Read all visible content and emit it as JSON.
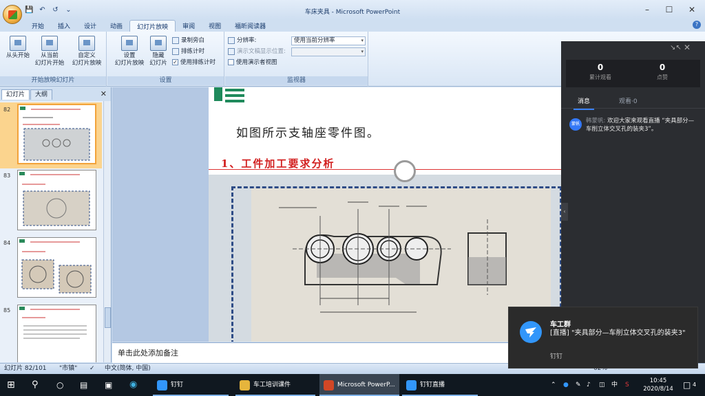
{
  "window": {
    "title": "车床夹具 - Microsoft PowerPoint"
  },
  "ribbon_tabs": [
    "开始",
    "插入",
    "设计",
    "动画",
    "幻灯片放映",
    "审阅",
    "视图",
    "福昕阅读器"
  ],
  "ribbon": {
    "group1": {
      "label": "开始放映幻灯片",
      "buttons": [
        {
          "line1": "从头开始",
          "line2": ""
        },
        {
          "line1": "从当前",
          "line2": "幻灯片开始"
        },
        {
          "line1": "自定义",
          "line2": "幻灯片放映"
        }
      ]
    },
    "group2": {
      "label": "设置",
      "buttons": [
        {
          "line1": "设置",
          "line2": "幻灯片放映"
        },
        {
          "line1": "隐藏",
          "line2": "幻灯片"
        }
      ],
      "small": {
        "record": "录制旁白",
        "rehearse": "排练计时",
        "use_timing": "使用排练计时"
      }
    },
    "group3": {
      "label": "监视器",
      "resolution_label": "分辨率:",
      "resolution_value": "使用当前分辨率",
      "show_on_label": "演示文稿显示位置:",
      "presenter_view": "使用演示者视图"
    }
  },
  "leftpane": {
    "tabs": [
      "幻灯片",
      "大纲"
    ],
    "slide_numbers": [
      "82",
      "83",
      "84",
      "85"
    ]
  },
  "slide": {
    "heading": "如图所示支轴座零件图。",
    "subheading": "1、工件加工要求分析"
  },
  "notes_placeholder": "单击此处添加备注",
  "statusbar": {
    "slide_info": "幻灯片 82/101",
    "theme": "\"市镇\"",
    "language": "中文(简体, 中国)",
    "zoom": "62%"
  },
  "live_panel": {
    "views_count": "0",
    "views_label": "累计观看",
    "likes_count": "0",
    "likes_label": "点赞",
    "tab_messages": "消息",
    "tab_viewers": "观看·0",
    "message": {
      "avatar": "蒙帆",
      "sender": "韩蒙帆:",
      "text": "欢迎大家来观看直播 “夹具部分—车削立体交叉孔的装夹3”。"
    }
  },
  "toast": {
    "title": "车工群",
    "body": "[直播] \"夹具部分—车削立体交叉孔的装夹3\"",
    "app": "钉钉"
  },
  "taskbar": {
    "apps": [
      {
        "label": "钉钉",
        "color": "#3296fa"
      },
      {
        "label": "车工培训课件",
        "color": "#e6b53c"
      },
      {
        "label": "Microsoft PowerP...",
        "color": "#d24726"
      },
      {
        "label": "钉钉直播",
        "color": "#3296fa"
      }
    ],
    "ime": "中",
    "time": "10:45",
    "date": "2020/8/14",
    "notifications": "4"
  }
}
